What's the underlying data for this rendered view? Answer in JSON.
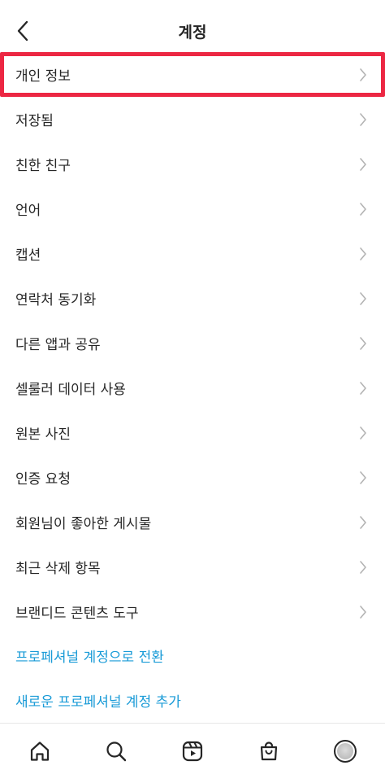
{
  "header": {
    "title": "계정"
  },
  "menu": [
    {
      "label": "개인 정보"
    },
    {
      "label": "저장됨"
    },
    {
      "label": "친한 친구"
    },
    {
      "label": "언어"
    },
    {
      "label": "캡션"
    },
    {
      "label": "연락처 동기화"
    },
    {
      "label": "다른 앱과 공유"
    },
    {
      "label": "셀룰러 데이터 사용"
    },
    {
      "label": "원본 사진"
    },
    {
      "label": "인증 요청"
    },
    {
      "label": "회원님이 좋아한 게시물"
    },
    {
      "label": "최근 삭제 항목"
    },
    {
      "label": "브랜디드 콘텐츠 도구"
    }
  ],
  "links": {
    "switch_professional": "프로페셔널 계정으로 전환",
    "add_professional": "새로운 프로페셔널 계정 추가"
  },
  "colors": {
    "highlight": "#ec2743",
    "link": "#1a9bd7",
    "text": "#262626"
  },
  "icons": {
    "back": "chevron-left-icon",
    "row_arrow": "chevron-right-icon",
    "home": "home-icon",
    "search": "search-icon",
    "reels": "reels-icon",
    "shop": "shopping-bag-icon",
    "profile": "profile-avatar"
  }
}
